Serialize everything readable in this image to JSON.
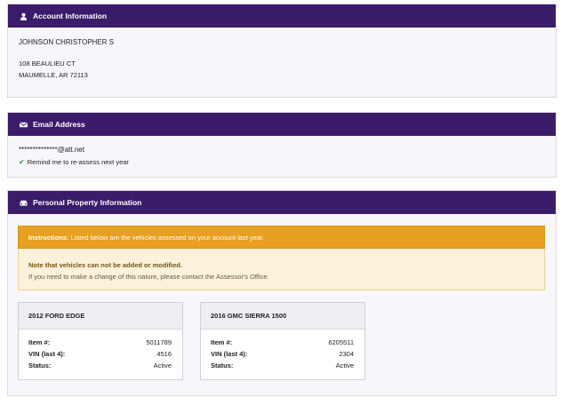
{
  "account": {
    "title": "Account Information",
    "name": "JOHNSON CHRISTOPHER S",
    "address_line1": "108 BEAULIEU CT",
    "address_line2": "MAUMELLE, AR 72113"
  },
  "email": {
    "title": "Email Address",
    "address": "**************@att.net",
    "reminder": "Remind me to re-assess next year"
  },
  "property": {
    "title": "Personal Property Information",
    "instructions_label": "Instructions:",
    "instructions_text": "Listed below are the vehicles assessed on your account last year.",
    "note_title": "Note that vehicles can not be added or modified.",
    "note_body": "If you need to make a change of this nature, please contact the Assessor's Office.",
    "vehicles": [
      {
        "title": "2012 FORD EDGE",
        "item_label": "Item #:",
        "item": "5011789",
        "vin_label": "VIN (last 4):",
        "vin": "4516",
        "status_label": "Status:",
        "status": "Active"
      },
      {
        "title": "2016 GMC SIERRA 1500",
        "item_label": "Item #:",
        "item": "6205511",
        "vin_label": "VIN (last 4):",
        "vin": "2304",
        "status_label": "Status:",
        "status": "Active"
      }
    ]
  },
  "colors": {
    "header": "#3a1c6b",
    "warning": "#e8a020",
    "check": "#2f9a3a"
  },
  "icons": {
    "account": "user-icon",
    "email": "envelope-icon",
    "property": "car-icon",
    "reminder": "checkmark-icon"
  }
}
